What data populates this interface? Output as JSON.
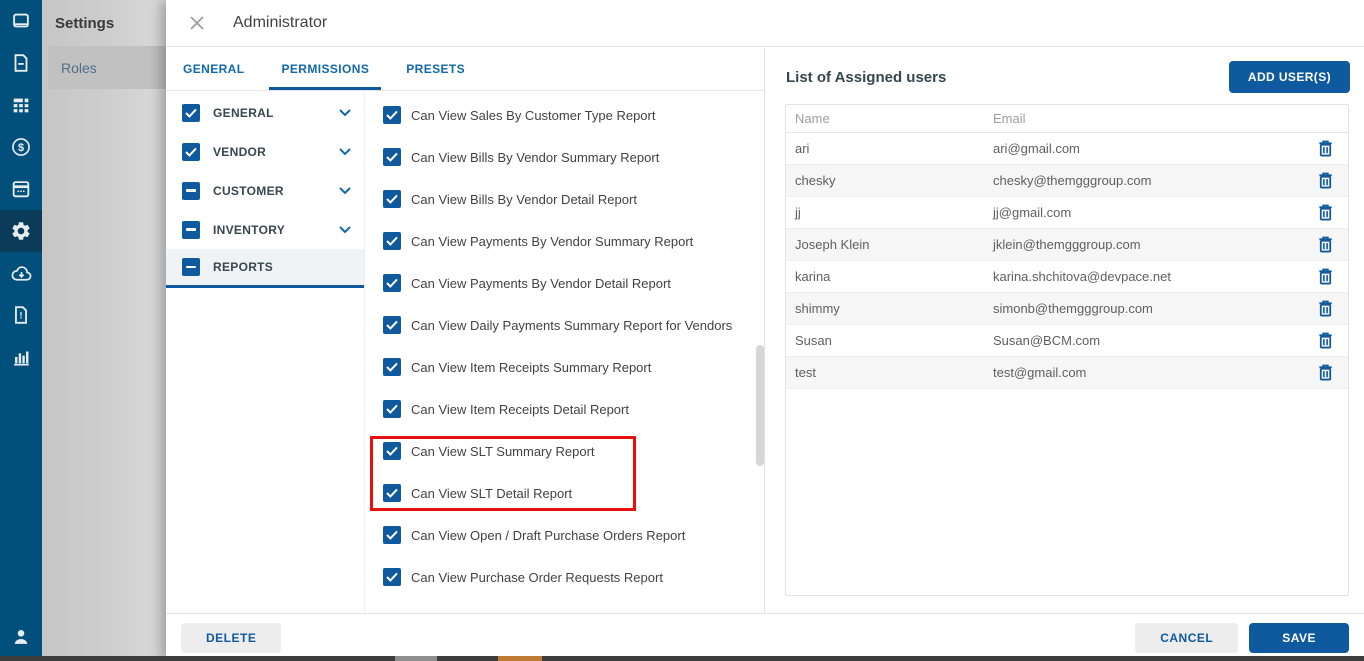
{
  "colors": {
    "accent": "#0f5a9e",
    "sidebar": "#01507b",
    "sidebar_active": "#0a3b58",
    "highlight_red": "#e8100c"
  },
  "sidebar": {
    "items": [
      {
        "icon": "window-icon"
      },
      {
        "icon": "document-icon"
      },
      {
        "icon": "table-icon"
      },
      {
        "icon": "dollar-icon"
      },
      {
        "icon": "calendar-icon"
      },
      {
        "icon": "gear-icon",
        "active": true
      },
      {
        "icon": "cloud-download-icon"
      },
      {
        "icon": "file-alert-icon"
      },
      {
        "icon": "bar-chart-icon"
      }
    ],
    "bottom_icon": "person-icon"
  },
  "settings_panel": {
    "title": "Settings",
    "items": [
      {
        "label": "Roles",
        "selected": true
      }
    ]
  },
  "modal": {
    "title": "Administrator",
    "tabs": [
      {
        "label": "GENERAL",
        "active": false
      },
      {
        "label": "PERMISSIONS",
        "active": true
      },
      {
        "label": "PRESETS",
        "active": false
      }
    ],
    "categories": [
      {
        "label": "GENERAL",
        "state": "checked",
        "chevron": true,
        "selected": false
      },
      {
        "label": "VENDOR",
        "state": "checked",
        "chevron": true,
        "selected": false
      },
      {
        "label": "CUSTOMER",
        "state": "indeterminate",
        "chevron": true,
        "selected": false
      },
      {
        "label": "INVENTORY",
        "state": "indeterminate",
        "chevron": true,
        "selected": false
      },
      {
        "label": "REPORTS",
        "state": "indeterminate",
        "chevron": false,
        "selected": true
      }
    ],
    "permissions": [
      {
        "label": "Can View Sales By Customer Type Report",
        "checked": true,
        "highlighted": false
      },
      {
        "label": "Can View Bills By Vendor Summary Report",
        "checked": true,
        "highlighted": false
      },
      {
        "label": "Can View Bills By Vendor Detail Report",
        "checked": true,
        "highlighted": false
      },
      {
        "label": "Can View Payments By Vendor Summary Report",
        "checked": true,
        "highlighted": false
      },
      {
        "label": "Can View Payments By Vendor Detail Report",
        "checked": true,
        "highlighted": false
      },
      {
        "label": "Can View Daily Payments Summary Report for Vendors",
        "checked": true,
        "highlighted": false
      },
      {
        "label": "Can View Item Receipts Summary Report",
        "checked": true,
        "highlighted": false
      },
      {
        "label": "Can View Item Receipts Detail Report",
        "checked": true,
        "highlighted": false
      },
      {
        "label": "Can View SLT Summary Report",
        "checked": true,
        "highlighted": true
      },
      {
        "label": "Can View SLT Detail Report",
        "checked": true,
        "highlighted": true
      },
      {
        "label": "Can View Open / Draft Purchase Orders Report",
        "checked": true,
        "highlighted": false
      },
      {
        "label": "Can View Purchase Order Requests Report",
        "checked": true,
        "highlighted": false
      }
    ],
    "assigned_users": {
      "title": "List of Assigned users",
      "add_button_label": "ADD USER(S)",
      "columns": [
        "Name",
        "Email"
      ],
      "delete_icon": "trash-icon",
      "rows": [
        {
          "name": "ari",
          "email": "ari@gmail.com"
        },
        {
          "name": "chesky",
          "email": "chesky@themgggroup.com"
        },
        {
          "name": "jj",
          "email": "jj@gmail.com"
        },
        {
          "name": "Joseph Klein",
          "email": "jklein@themgggroup.com"
        },
        {
          "name": "karina",
          "email": "karina.shchitova@devpace.net"
        },
        {
          "name": "shimmy",
          "email": "simonb@themgggroup.com"
        },
        {
          "name": "Susan",
          "email": "Susan@BCM.com"
        },
        {
          "name": "test",
          "email": "test@gmail.com"
        }
      ]
    },
    "footer": {
      "delete_label": "DELETE",
      "cancel_label": "CANCEL",
      "save_label": "SAVE"
    }
  }
}
